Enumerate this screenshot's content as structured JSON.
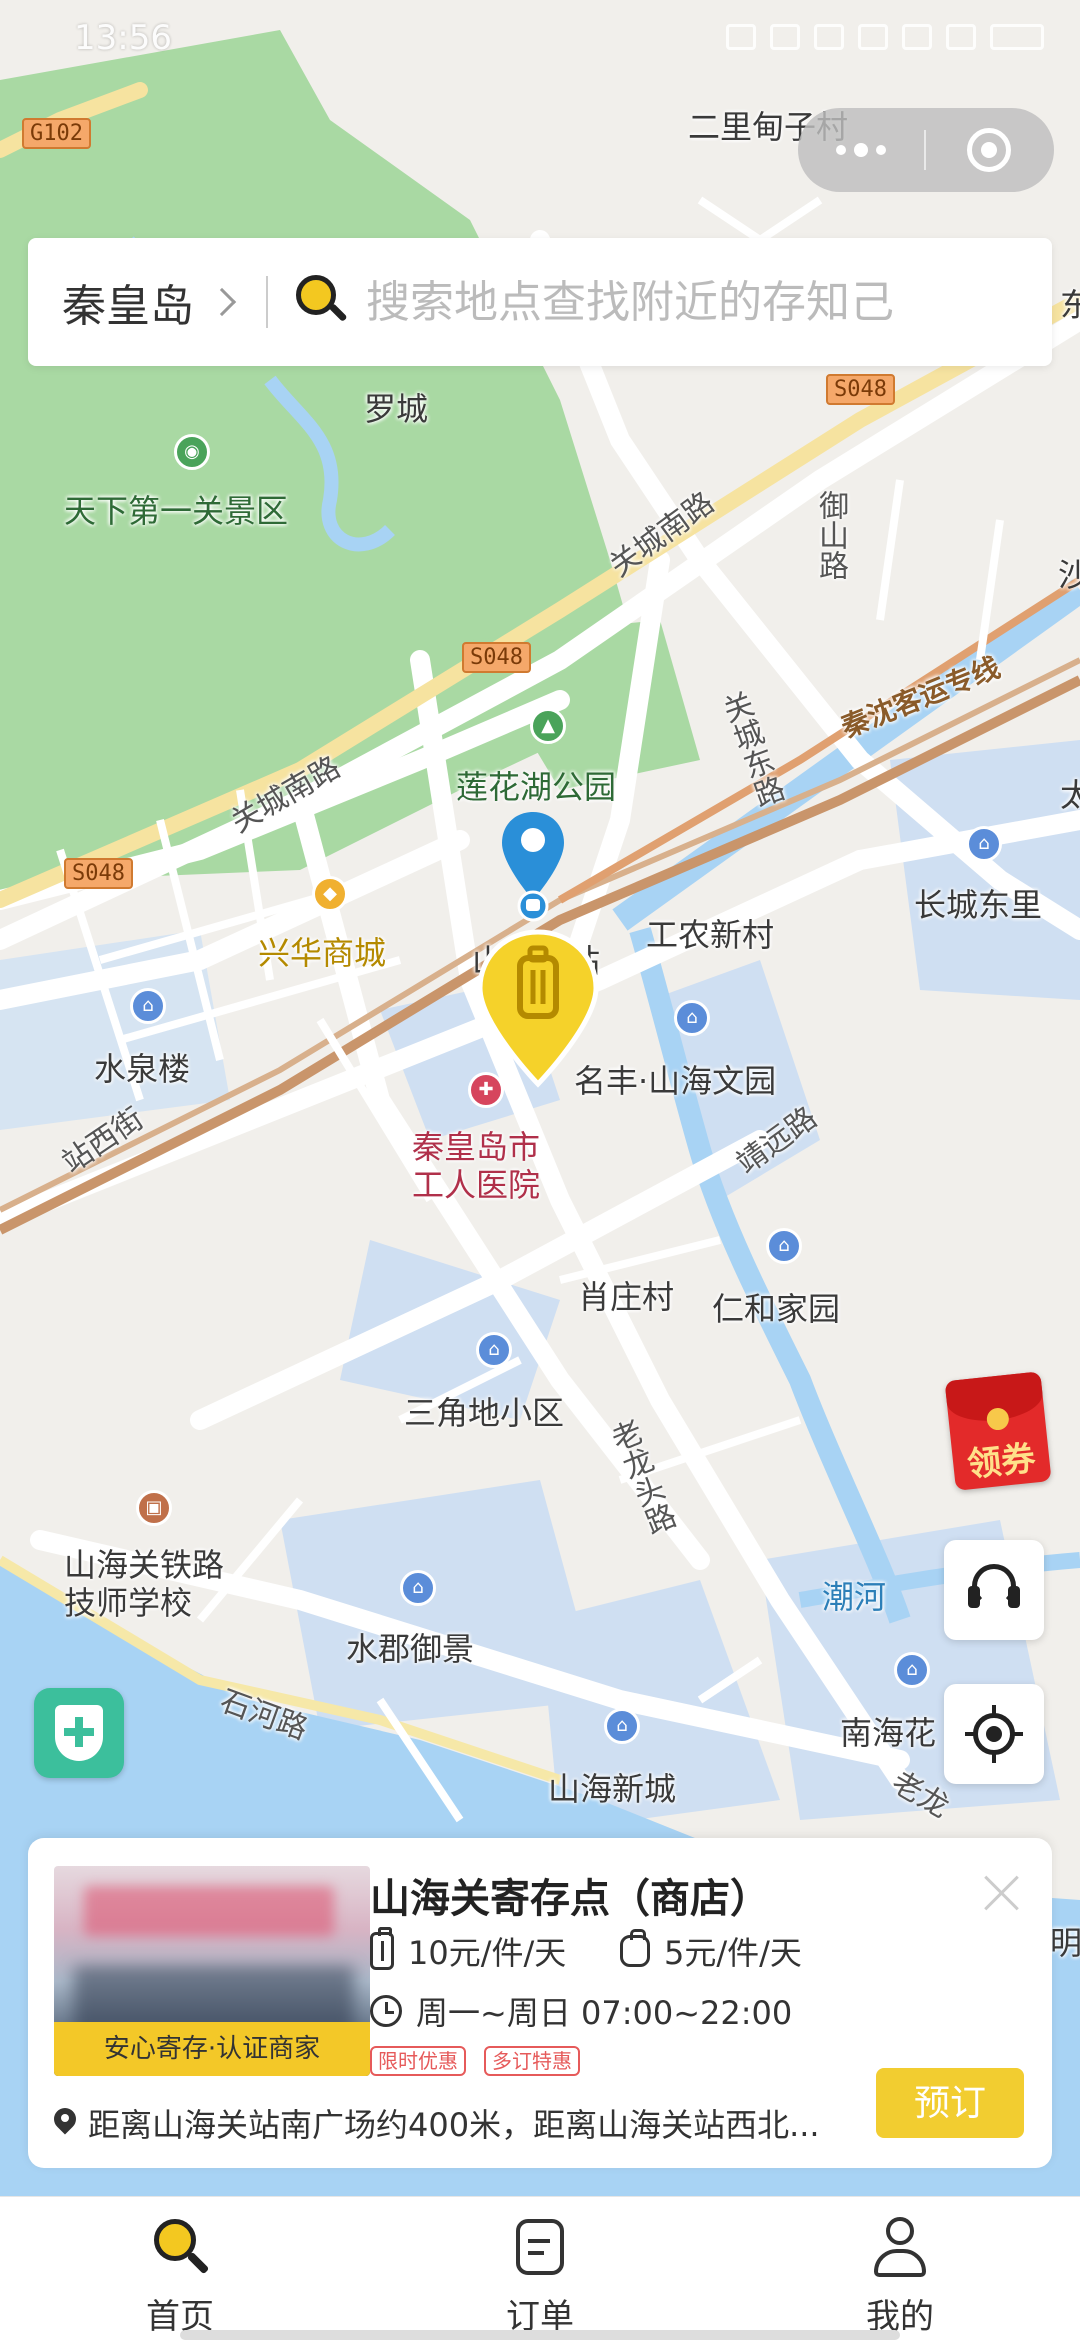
{
  "status_bar": {
    "time": "13:56"
  },
  "search": {
    "city": "秦皇岛",
    "placeholder": "搜索地点查找附近的存知己"
  },
  "map": {
    "labels": {
      "village_north": "二里甸子村",
      "luocheng": "罗城",
      "scenic_area": "天下第一关景区",
      "guancheng_s_road_1": "关城南路",
      "yushan_road": "御山路",
      "guancheng_e_road": "关城东路",
      "rail_line": "秦沈客运专线",
      "guancheng_s_road_2": "关城南路",
      "lianhuahu_park": "莲花湖公园",
      "xinghua_mall": "兴华商城",
      "station": "山海关站",
      "gongnong_village": "工农新村",
      "changcheng_dongli": "长城东里",
      "shuiquan_lou": "水泉楼",
      "zhanxi_street": "站西街",
      "mingfeng": "名丰·山海文园",
      "hospital": "秦皇岛市工人医院",
      "jingyuan_road": "靖远路",
      "xiaozhuang_village": "肖庄村",
      "renhe_jiayuan": "仁和家园",
      "sanjiaodi": "三角地小区",
      "laolongtou_road": "老龙头路",
      "railway_school": "山海关铁路技师学校",
      "chao_river": "潮河",
      "shuijun_yujing": "水郡御景",
      "shihe_road": "石河路",
      "nanhai": "南海花",
      "shanhai_xincheng": "山海新城",
      "laolong_right": "老龙",
      "ming_right": "明",
      "dong_edge": "东",
      "shi_edge": "沙",
      "tai_edge": "太"
    },
    "shields": [
      "G102",
      "S048",
      "S048",
      "S048"
    ]
  },
  "coupon": {
    "label": "领券"
  },
  "store": {
    "name": "山海关寄存点（商店）",
    "badge": "安心寄存·认证商家",
    "price_large": "10元/件/天",
    "price_small": "5元/件/天",
    "hours": "周一~周日 07:00~22:00",
    "tags": [
      "限时优惠",
      "多订特惠"
    ],
    "address": "距离山海关站南广场约400米，距离山海关站西北...",
    "book_label": "预订"
  },
  "nav": [
    {
      "label": "首页",
      "icon": "search-icon"
    },
    {
      "label": "订单",
      "icon": "order-icon"
    },
    {
      "label": "我的",
      "icon": "user-icon"
    }
  ],
  "colors": {
    "accent_yellow": "#f2cd30",
    "park_green": "#a9d9a3",
    "water_blue": "#a8d3f4",
    "pin_blue": "#2a8fd8",
    "safety_green": "#3cbf9c"
  }
}
